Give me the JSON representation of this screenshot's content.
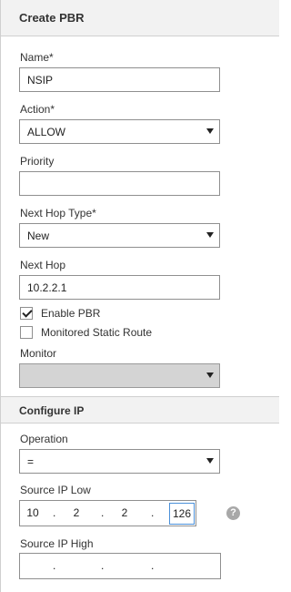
{
  "header": {
    "title": "Create PBR"
  },
  "fields": {
    "name": {
      "label": "Name*",
      "value": "NSIP"
    },
    "action": {
      "label": "Action*",
      "selected": "ALLOW"
    },
    "priority": {
      "label": "Priority",
      "value": ""
    },
    "next_hop_type": {
      "label": "Next Hop Type*",
      "selected": "New"
    },
    "next_hop": {
      "label": "Next Hop",
      "value": "10.2.2.1"
    },
    "enable_pbr": {
      "label": "Enable PBR",
      "checked": true
    },
    "monitored_static_route": {
      "label": "Monitored Static Route",
      "checked": false
    },
    "monitor": {
      "label": "Monitor",
      "selected": ""
    }
  },
  "configure_ip": {
    "title": "Configure IP",
    "operation": {
      "label": "Operation",
      "selected": "="
    },
    "source_ip_low": {
      "label": "Source IP Low",
      "octets": [
        "10",
        "2",
        "2",
        "126"
      ],
      "separator": "."
    },
    "source_ip_high": {
      "label": "Source IP High",
      "octets": [
        "",
        "",
        "",
        ""
      ],
      "separator": "."
    },
    "help_icon": "question-mark-icon",
    "help_glyph": "?"
  }
}
